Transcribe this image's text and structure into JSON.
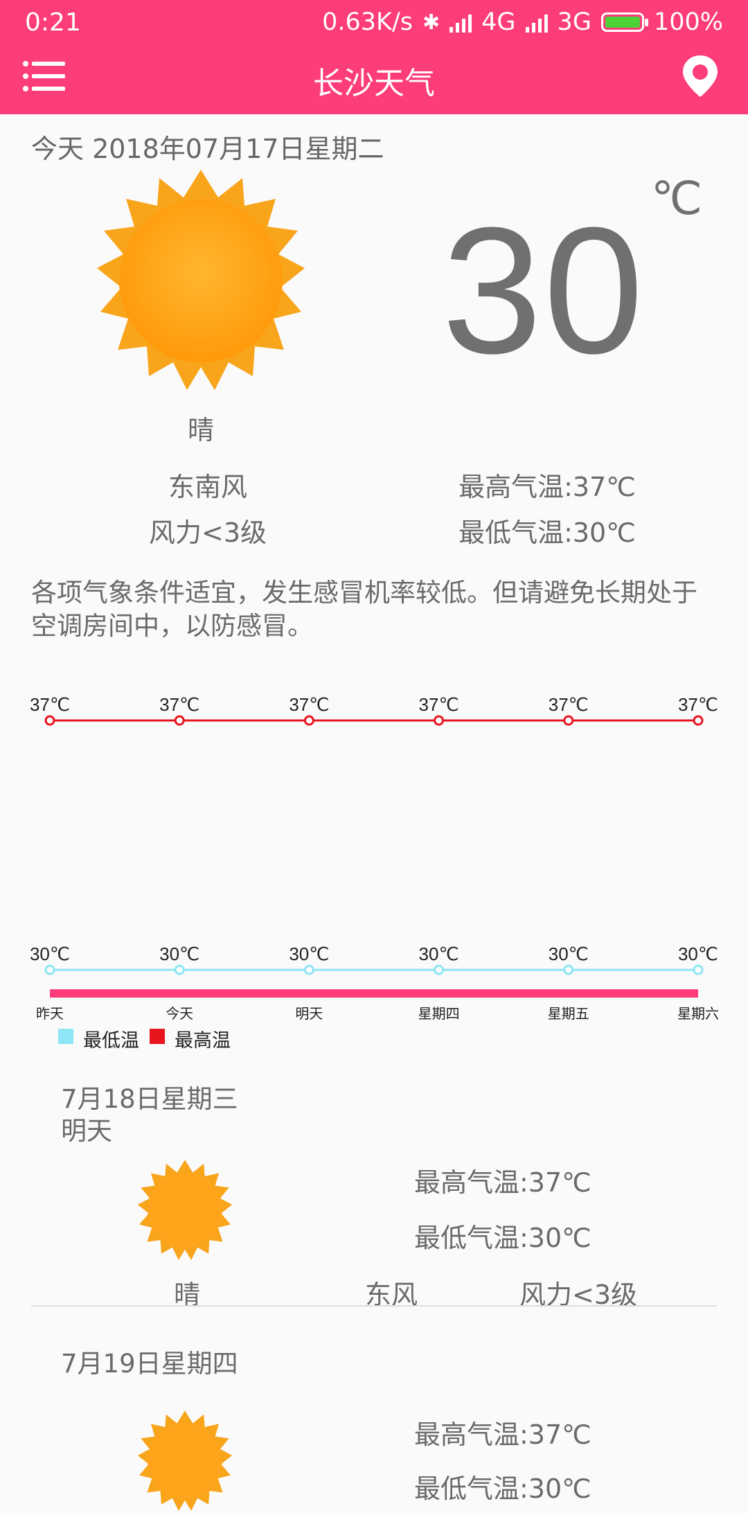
{
  "status_bar": {
    "time": "0:21",
    "net_speed": "0.63K/s",
    "network_4g": "4G",
    "network_3g": "3G",
    "battery": "100%"
  },
  "toolbar": {
    "title": "长沙天气"
  },
  "today": {
    "date": "今天  2018年07月17日星期二",
    "temperature": "30",
    "unit": "℃",
    "condition": "晴",
    "wind_dir": "东南风",
    "wind_level": "风力<3级",
    "high": "最高气温:37℃",
    "low": "最低气温:30℃",
    "tip": "各项气象条件适宜，发生感冒机率较低。但请避免长期处于空调房间中，以防感冒。"
  },
  "chart_data": {
    "type": "line",
    "categories": [
      "昨天",
      "今天",
      "明天",
      "星期四",
      "星期五",
      "星期六"
    ],
    "series": [
      {
        "name": "最高温",
        "values": [
          37,
          37,
          37,
          37,
          37,
          37
        ],
        "color": "#e8141e"
      },
      {
        "name": "最低温",
        "values": [
          30,
          30,
          30,
          30,
          30,
          30
        ],
        "color": "#8de5f5"
      }
    ],
    "value_labels_high": [
      "37℃",
      "37℃",
      "37℃",
      "37℃",
      "37℃",
      "37℃"
    ],
    "value_labels_low": [
      "30℃",
      "30℃",
      "30℃",
      "30℃",
      "30℃",
      "30℃"
    ],
    "legend": [
      "最低温",
      "最高温"
    ],
    "bar_color": "#fd3d7a"
  },
  "forecast": [
    {
      "date": "7月18日星期三",
      "label": "明天",
      "high": "最高气温:37℃",
      "low": "最低气温:30℃",
      "condition": "晴",
      "wind_dir": "东风",
      "wind_level": "风力<3级"
    },
    {
      "date": "7月19日星期四",
      "high": "最高气温:37℃",
      "low": "最低气温:30℃"
    }
  ],
  "colors": {
    "accent": "#fd3d7a",
    "sun": "#ffa41b"
  }
}
